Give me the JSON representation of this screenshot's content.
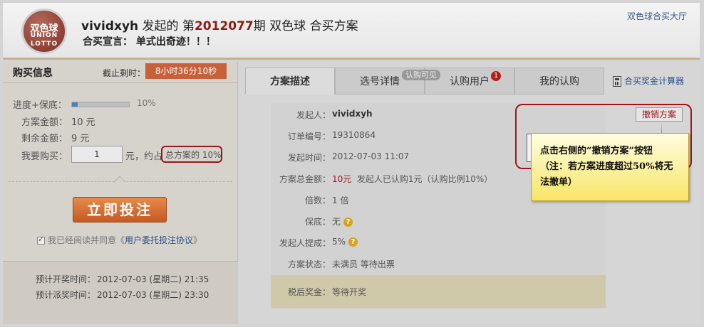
{
  "header": {
    "logo": {
      "line1": "双色球",
      "line2": "UNION",
      "line3": "LOTTO"
    },
    "initiator": "vividxyh",
    "initiated_text": "发起的",
    "issue_prefix": "第",
    "issue_number": "2012077",
    "issue_suffix": "期",
    "lottery_name": "双色球 合买方案",
    "declaration_label": "合买宣言：",
    "declaration_text": "单式出奇迹！！！",
    "hall_link": "双色球合买大厅"
  },
  "purchase": {
    "title": "购买信息",
    "deadline_label": "截止剩时：",
    "countdown": "8小时36分10秒",
    "progress_label": "进度+保底：",
    "progress_fraction": 0.1,
    "progress_text": "10%",
    "amount_label": "方案金额：",
    "amount_value": "10 元",
    "remaining_label": "剩余金额：",
    "remaining_value": "9 元",
    "buy_label": "我要购买：",
    "buy_value": "1",
    "buy_unit": "元，约占",
    "share_text": "总方案的 10%",
    "bet_button": "立即投注",
    "agree_prefix": "我已经阅读并同意《",
    "agree_link": "用户委托投注协议",
    "agree_suffix": "》",
    "draw_time_label": "预计开奖时间：",
    "draw_time_value": "2012-07-03 (星期二) 21:35",
    "payout_time_label": "预计派奖时间：",
    "payout_time_value": "2012-07-03 (星期二) 23:30"
  },
  "tabs": [
    {
      "label": "方案描述"
    },
    {
      "label": "选号详情",
      "badge": "认购可见"
    },
    {
      "label": "认购用户",
      "count": "1"
    },
    {
      "label": "我的认购"
    }
  ],
  "calculator_link": "合买奖金计算器",
  "details": [
    {
      "key": "发起人：",
      "value": "vividxyh"
    },
    {
      "key": "订单编号：",
      "value": "19310864"
    },
    {
      "key": "发起时间：",
      "value": "2012-07-03 11:07"
    },
    {
      "key": "方案总金额：",
      "value_red": "10元",
      "value": "发起人已认购1元（认购比例10%）"
    },
    {
      "key": "倍数：",
      "value": "1 倍"
    },
    {
      "key": "保底：",
      "value": "无"
    },
    {
      "key": "发起人提成：",
      "value": "5%"
    },
    {
      "key": "方案状态：",
      "value": "未满员 等待出票"
    }
  ],
  "tax": {
    "key": "税后奖金：",
    "value": "等待开奖"
  },
  "cancel_button": "撤销方案",
  "callout": {
    "line1": "点击右侧的“撤销方案”按钮",
    "line2": "（注：若方案进度超过50%将无法撤单）"
  },
  "colors": {
    "issue_red": "#8b1d12",
    "countdown_bg": "#c8613a",
    "bet_button": "#d8702f",
    "highlight_red": "#a0151a",
    "callout_yellow": "#f7e667",
    "link_blue": "#2a4f86"
  }
}
